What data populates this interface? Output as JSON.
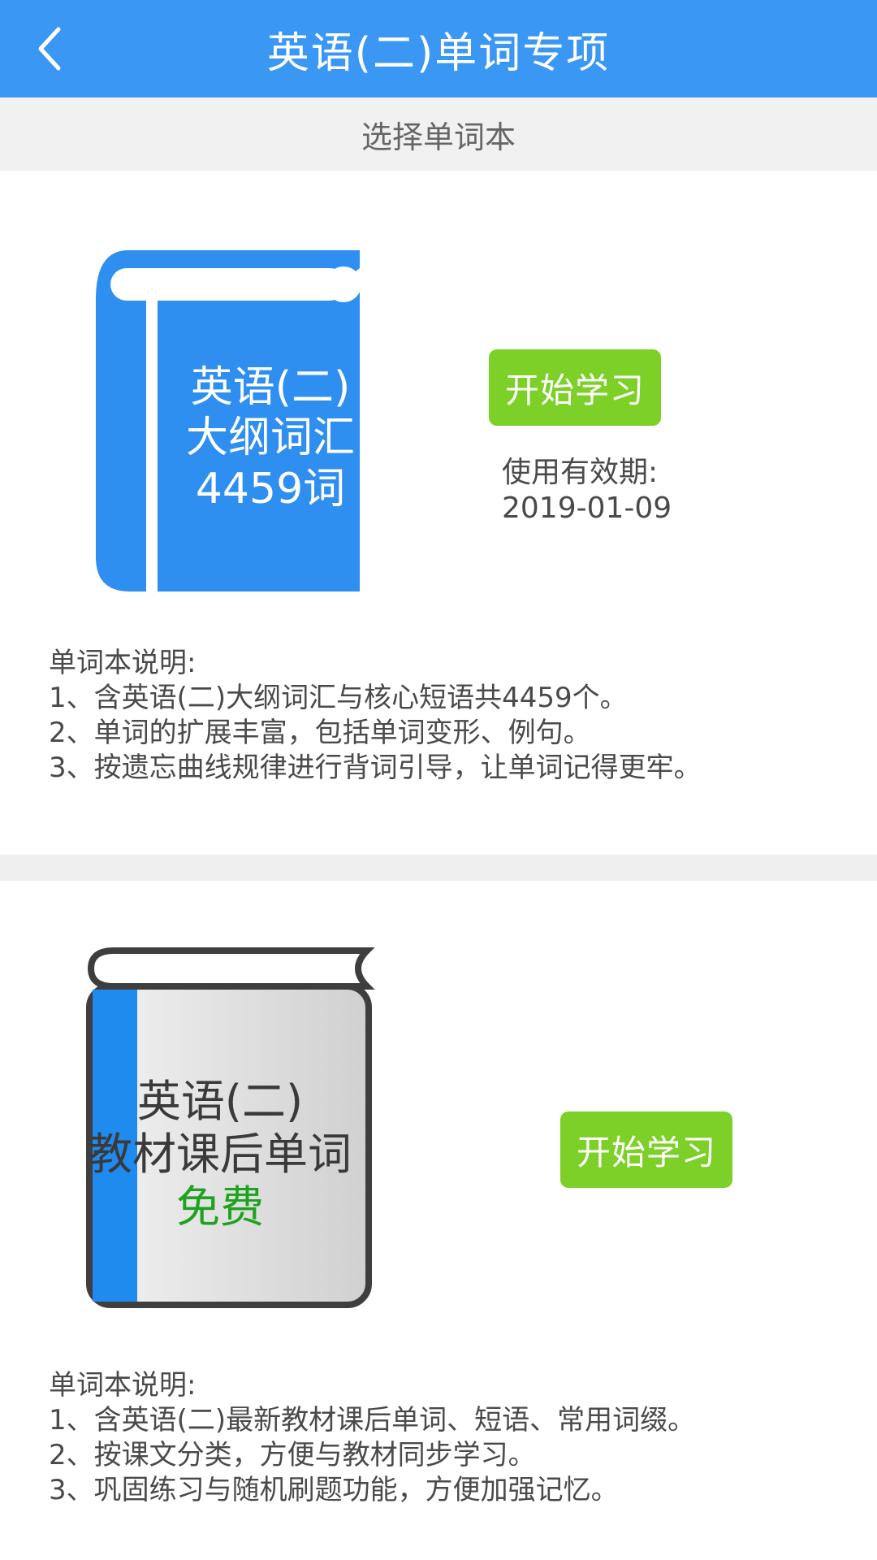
{
  "header": {
    "back_icon": "chevron-left-icon",
    "title": "英语(二)单词专项",
    "bg_color": "#3a97f3"
  },
  "subheader": {
    "label": "选择单词本"
  },
  "books": [
    {
      "cover_lines": [
        "英语(二)",
        "大纲词汇",
        "4459词"
      ],
      "cover_color": "#2f8ff0",
      "start_label": "开始学习",
      "validity_label": "使用有效期:",
      "validity_date": "2019-01-09",
      "desc_title": "单词本说明:",
      "desc_items": [
        "1、含英语(二)大纲词汇与核心短语共4459个。",
        "2、单词的扩展丰富，包括单词变形、例句。",
        "3、按遗忘曲线规律进行背词引导，让单词记得更牢。"
      ]
    },
    {
      "cover_lines": [
        "英语(二)",
        "教材课后单词"
      ],
      "cover_badge": "免费",
      "cover_color": "#dcdcdc",
      "start_label": "开始学习",
      "desc_title": "单词本说明:",
      "desc_items": [
        "1、含英语(二)最新教材课后单词、短语、常用词缀。",
        "2、按课文分类，方便与教材同步学习。",
        "3、巩固练习与随机刷题功能，方便加强记忆。"
      ]
    }
  ],
  "colors": {
    "start_button": "#7cd027",
    "free_badge": "#1fa21f"
  }
}
